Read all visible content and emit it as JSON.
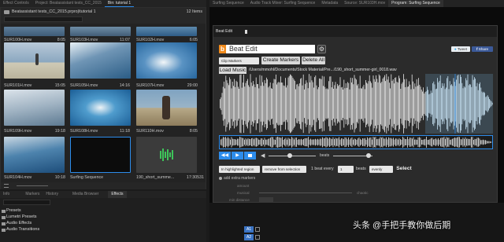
{
  "top_tabs": {
    "effect_controls": "Effect Controls",
    "project": "Project: Beatassistant tests_CC_2015",
    "bin": "Bin: tutorial 1",
    "source_seq": "Surfing Sequence",
    "audio_mixer": "Audio Track Mixer: Surfing Sequence",
    "metadata": "Metadata",
    "source": "Source: SUR103H.mov",
    "program": "Program: Surfing Sequence"
  },
  "bin": {
    "path": "Beatassistant tests_CC_2015.prproj\\tutorial 1",
    "item_count": "12 Items",
    "items": [
      {
        "name": "SUR100H.mov",
        "duration": "8:05"
      },
      {
        "name": "SUR103H.mov",
        "duration": "11:07"
      },
      {
        "name": "SUR102H.mov",
        "duration": "6:05"
      },
      {
        "name": "SUR101H.mov",
        "duration": "15:05"
      },
      {
        "name": "SUR105H.mov",
        "duration": "14:16"
      },
      {
        "name": "SUR107H.mov",
        "duration": "29:00"
      },
      {
        "name": "SUR109H.mov",
        "duration": "19:18"
      },
      {
        "name": "SUR108H.mov",
        "duration": "11:18"
      },
      {
        "name": "SUR110H.mov",
        "duration": "8:05"
      },
      {
        "name": "SUR104H.mov",
        "duration": "10:18"
      },
      {
        "name": "Surfing Sequence",
        "duration": ""
      },
      {
        "name": "190_short_summe...",
        "duration": "17:30531"
      }
    ]
  },
  "lower_tabs": {
    "info": "Info",
    "markers": "Markers",
    "history": "History",
    "media_browser": "Media Browser",
    "effects": "Effects"
  },
  "effects_tree": [
    "Presets",
    "Lumetri Presets",
    "Audio Effects",
    "Audio Transitions"
  ],
  "beat_edit": {
    "panel_tab": "Beat Edit",
    "title": "Beat Edit",
    "tweet": "Tweet",
    "share": "Share",
    "clip_markers": "Clip Markers",
    "create_markers": "Create Markers",
    "delete_all": "Delete All",
    "load_music": "Load Music",
    "music_path": "/Users/mmohl/Documents/Stock Material/Pre.../190_short_summer-girl_0018.wav",
    "beats_label": "beats",
    "region_select": "In highlighted region",
    "remove_select": "remove from selection",
    "beat_every_prefix": "1 beat every",
    "beat_every_value": "1",
    "beats_word": "beats",
    "evenly": "evenly",
    "select": "Select",
    "add_extra_markers": "add extra markers",
    "amount": "amount",
    "musical": "musical",
    "chaotic": "chaotic",
    "min_distance": "min distance"
  },
  "timeline": {
    "track_a1": "A1",
    "track_a2": "A2"
  },
  "watermark": "头条 @手把手教你做后期",
  "colors": {
    "accent_blue": "#2d8ceb",
    "waveform_selection": "#8fc3e6",
    "beat_edit_orange": "#f08a1c"
  }
}
